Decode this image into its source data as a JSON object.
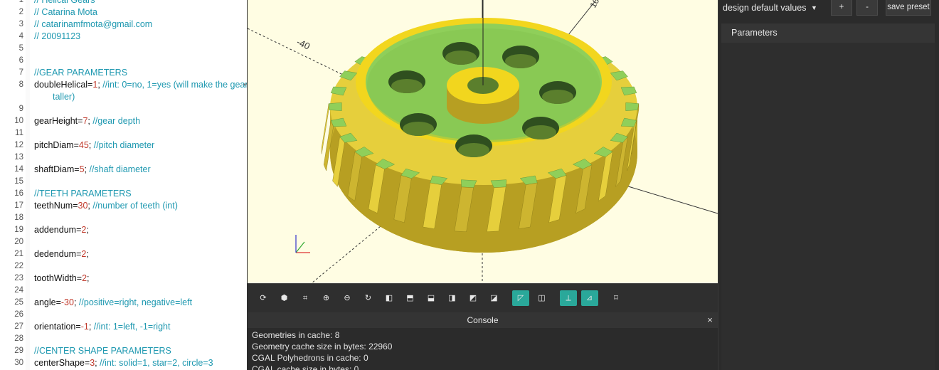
{
  "editor": {
    "lines": [
      {
        "n": "1",
        "parts": [
          {
            "t": "// Helical Gears",
            "c": "cm"
          }
        ]
      },
      {
        "n": "2",
        "parts": [
          {
            "t": "// Catarina Mota",
            "c": "cm"
          }
        ]
      },
      {
        "n": "3",
        "parts": [
          {
            "t": "// catarinamfmota@gmail.com",
            "c": "cm"
          }
        ]
      },
      {
        "n": "4",
        "parts": [
          {
            "t": "// 20091123",
            "c": "cm"
          }
        ]
      },
      {
        "n": "5",
        "parts": []
      },
      {
        "n": "6",
        "parts": []
      },
      {
        "n": "7",
        "parts": [
          {
            "t": "//GEAR PARAMETERS",
            "c": "cm"
          }
        ]
      },
      {
        "n": "8",
        "parts": [
          {
            "t": "doubleHelical=",
            "c": "kw"
          },
          {
            "t": "1",
            "c": "num"
          },
          {
            "t": "; ",
            "c": "kw"
          },
          {
            "t": "//int: 0=no, 1=yes (will make the gear 2x",
            "c": "cm"
          }
        ],
        "cont": "taller)"
      },
      {
        "n": "9",
        "parts": []
      },
      {
        "n": "10",
        "parts": [
          {
            "t": "gearHeight=",
            "c": "kw"
          },
          {
            "t": "7",
            "c": "num"
          },
          {
            "t": "; ",
            "c": "kw"
          },
          {
            "t": "//gear depth",
            "c": "cm"
          }
        ]
      },
      {
        "n": "11",
        "parts": []
      },
      {
        "n": "12",
        "parts": [
          {
            "t": "pitchDiam=",
            "c": "kw"
          },
          {
            "t": "45",
            "c": "num"
          },
          {
            "t": "; ",
            "c": "kw"
          },
          {
            "t": "//pitch diameter",
            "c": "cm"
          }
        ]
      },
      {
        "n": "13",
        "parts": []
      },
      {
        "n": "14",
        "parts": [
          {
            "t": "shaftDiam=",
            "c": "kw"
          },
          {
            "t": "5",
            "c": "num"
          },
          {
            "t": "; ",
            "c": "kw"
          },
          {
            "t": "//shaft diameter",
            "c": "cm"
          }
        ]
      },
      {
        "n": "15",
        "parts": []
      },
      {
        "n": "16",
        "parts": [
          {
            "t": "//TEETH PARAMETERS",
            "c": "cm"
          }
        ]
      },
      {
        "n": "17",
        "parts": [
          {
            "t": "teethNum=",
            "c": "kw"
          },
          {
            "t": "30",
            "c": "num"
          },
          {
            "t": "; ",
            "c": "kw"
          },
          {
            "t": "//number of teeth (int)",
            "c": "cm"
          }
        ]
      },
      {
        "n": "18",
        "parts": []
      },
      {
        "n": "19",
        "parts": [
          {
            "t": "addendum=",
            "c": "kw"
          },
          {
            "t": "2",
            "c": "num"
          },
          {
            "t": ";",
            "c": "kw"
          }
        ]
      },
      {
        "n": "20",
        "parts": []
      },
      {
        "n": "21",
        "parts": [
          {
            "t": "dedendum=",
            "c": "kw"
          },
          {
            "t": "2",
            "c": "num"
          },
          {
            "t": ";",
            "c": "kw"
          }
        ]
      },
      {
        "n": "22",
        "parts": []
      },
      {
        "n": "23",
        "parts": [
          {
            "t": "toothWidth=",
            "c": "kw"
          },
          {
            "t": "2",
            "c": "num"
          },
          {
            "t": ";",
            "c": "kw"
          }
        ]
      },
      {
        "n": "24",
        "parts": []
      },
      {
        "n": "25",
        "parts": [
          {
            "t": "angle=",
            "c": "kw"
          },
          {
            "t": "-30",
            "c": "num"
          },
          {
            "t": "; ",
            "c": "kw"
          },
          {
            "t": "//positive=right, negative=left",
            "c": "cm"
          }
        ]
      },
      {
        "n": "26",
        "parts": []
      },
      {
        "n": "27",
        "parts": [
          {
            "t": "orientation=",
            "c": "kw"
          },
          {
            "t": "-1",
            "c": "num"
          },
          {
            "t": "; ",
            "c": "kw"
          },
          {
            "t": "//int: 1=left, -1=right",
            "c": "cm"
          }
        ]
      },
      {
        "n": "28",
        "parts": []
      },
      {
        "n": "29",
        "parts": [
          {
            "t": "//CENTER SHAPE PARAMETERS",
            "c": "cm"
          }
        ]
      },
      {
        "n": "30",
        "parts": [
          {
            "t": "centerShape=",
            "c": "kw"
          },
          {
            "t": "3",
            "c": "num"
          },
          {
            "t": "; ",
            "c": "kw"
          },
          {
            "t": "//int: solid=1, star=2, circle=3",
            "c": "cm"
          }
        ]
      }
    ],
    "wrap_marker": "⤶"
  },
  "viewport": {
    "axis_labels": {
      "neg_x": "-40",
      "pos_x_top": "10",
      "neg_y_top": "-5"
    },
    "colors": {
      "gear_top": "#8fcf5a",
      "gear_side": "#e6cf3c",
      "gear_dark": "#9b8a1d",
      "gear_rim": "#f2d61e",
      "bg": "#fffde3"
    }
  },
  "toolbar": {
    "buttons": [
      {
        "name": "render-preview-button",
        "glyph": "⟳",
        "active": false
      },
      {
        "name": "render-button",
        "glyph": "⬢",
        "active": false
      },
      {
        "name": "view-all-button",
        "glyph": "⌗",
        "active": false
      },
      {
        "name": "zoom-in-button",
        "glyph": "⊕",
        "active": false
      },
      {
        "name": "zoom-out-button",
        "glyph": "⊖",
        "active": false
      },
      {
        "name": "reset-view-button",
        "glyph": "↻",
        "active": false
      },
      {
        "name": "view-right-button",
        "glyph": "◧",
        "active": false
      },
      {
        "name": "view-top-button",
        "glyph": "⬒",
        "active": false
      },
      {
        "name": "view-bottom-button",
        "glyph": "⬓",
        "active": false
      },
      {
        "name": "view-left-button",
        "glyph": "◨",
        "active": false
      },
      {
        "name": "view-front-button",
        "glyph": "◩",
        "active": false
      },
      {
        "name": "view-back-button",
        "glyph": "◪",
        "active": false
      },
      {
        "name": "perspective-button",
        "glyph": "◸",
        "active": true
      },
      {
        "name": "orthogonal-button",
        "glyph": "◫",
        "active": false
      },
      {
        "name": "show-axes-button",
        "glyph": "⟂",
        "active": true
      },
      {
        "name": "show-scale-button",
        "glyph": "⊿",
        "active": true
      },
      {
        "name": "show-edges-button",
        "glyph": "⌑",
        "active": false
      }
    ]
  },
  "console": {
    "title": "Console",
    "close": "×",
    "lines": [
      "Geometries in cache: 8",
      "Geometry cache size in bytes: 22960",
      "CGAL Polyhedrons in cache: 0",
      "CGAL cache size in bytes: 0"
    ]
  },
  "customizer": {
    "preset": "design default values",
    "plus": "+",
    "minus": "-",
    "save": "save preset",
    "parameters_header": "Parameters"
  }
}
